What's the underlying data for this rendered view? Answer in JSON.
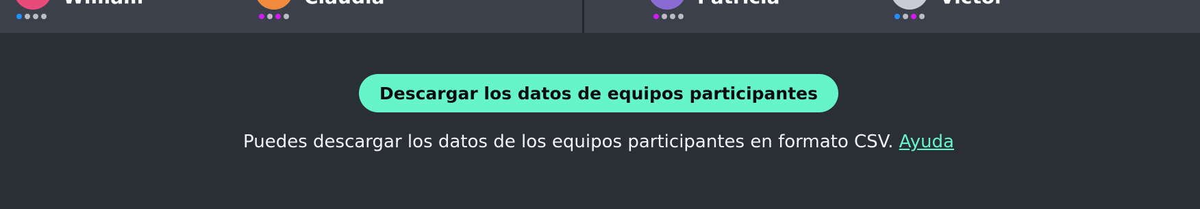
{
  "players": [
    {
      "name": "William",
      "avatar_colors": [
        "#e84a7a",
        "#f2c0d0"
      ],
      "dots": [
        "#1e90ff",
        "#b9bcc2",
        "#b9bcc2",
        "#b9bcc2"
      ]
    },
    {
      "name": "Claudia",
      "avatar_colors": [
        "#f08a3c",
        "#9fd6e8"
      ],
      "dots": [
        "#d11cf0",
        "#b9bcc2",
        "#d11cf0",
        "#b9bcc2"
      ]
    },
    {
      "name": "Patricia",
      "avatar_colors": [
        "#8a6bd6",
        "#d9d2f2"
      ],
      "dots": [
        "#d11cf0",
        "#b9bcc2",
        "#b9bcc2",
        "#b9bcc2"
      ]
    },
    {
      "name": "Victor",
      "avatar_colors": [
        "#c7ccd6",
        "#eef0f4"
      ],
      "dots": [
        "#1e90ff",
        "#b9bcc2",
        "#d11cf0",
        "#b9bcc2"
      ]
    }
  ],
  "download": {
    "button_label": "Descargar los datos de equipos participantes"
  },
  "info": {
    "text": "Puedes descargar los datos de los equipos participantes en formato CSV. ",
    "help_link": "Ayuda"
  },
  "colors": {
    "accent": "#66f5c8",
    "background": "#2a2e35",
    "strip": "#3b404a"
  }
}
